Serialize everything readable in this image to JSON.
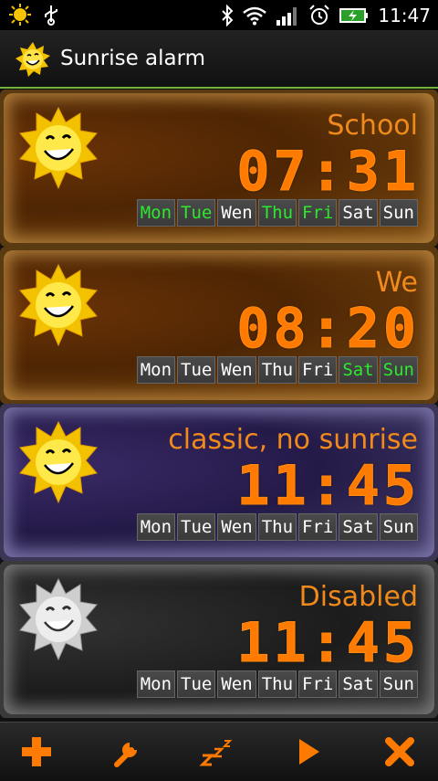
{
  "statusbar": {
    "time": "11:47"
  },
  "app": {
    "title": "Sunrise alarm"
  },
  "alarms": [
    {
      "name": "School",
      "time": "07:31",
      "days": [
        {
          "label": "Mon",
          "on": true
        },
        {
          "label": "Tue",
          "on": true
        },
        {
          "label": "Wen",
          "on": false
        },
        {
          "label": "Thu",
          "on": true
        },
        {
          "label": "Fri",
          "on": true
        },
        {
          "label": "Sat",
          "on": false
        },
        {
          "label": "Sun",
          "on": false
        }
      ]
    },
    {
      "name": "We",
      "time": "08:20",
      "days": [
        {
          "label": "Mon",
          "on": false
        },
        {
          "label": "Tue",
          "on": false
        },
        {
          "label": "Wen",
          "on": false
        },
        {
          "label": "Thu",
          "on": false
        },
        {
          "label": "Fri",
          "on": false
        },
        {
          "label": "Sat",
          "on": true
        },
        {
          "label": "Sun",
          "on": true
        }
      ]
    },
    {
      "name": "classic, no sunrise",
      "time": "11:45",
      "days": [
        {
          "label": "Mon",
          "on": false
        },
        {
          "label": "Tue",
          "on": false
        },
        {
          "label": "Wen",
          "on": false
        },
        {
          "label": "Thu",
          "on": false
        },
        {
          "label": "Fri",
          "on": false
        },
        {
          "label": "Sat",
          "on": false
        },
        {
          "label": "Sun",
          "on": false
        }
      ]
    },
    {
      "name": "Disabled",
      "time": "11:45",
      "days": [
        {
          "label": "Mon",
          "on": false
        },
        {
          "label": "Tue",
          "on": false
        },
        {
          "label": "Wen",
          "on": false
        },
        {
          "label": "Thu",
          "on": false
        },
        {
          "label": "Fri",
          "on": false
        },
        {
          "label": "Sat",
          "on": false
        },
        {
          "label": "Sun",
          "on": false
        }
      ]
    }
  ],
  "colors": {
    "accent": "#f08a1c",
    "day_on": "#2ee82e",
    "divider": "#6fb33d"
  },
  "toolbar": {
    "icons": [
      "plus-icon",
      "wrench-icon",
      "snooze-icon",
      "play-icon",
      "delete-icon"
    ]
  }
}
